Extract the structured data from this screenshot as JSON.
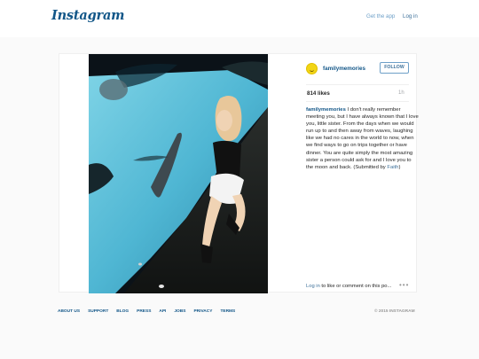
{
  "header": {
    "logo_text": "Instagram",
    "get_app": "Get the app",
    "login": "Log in"
  },
  "post": {
    "username": "familymemories",
    "follow_label": "FOLLOW",
    "likes": "814 likes",
    "time_ago": "1h",
    "caption_user": "familymemories",
    "caption_text": " I don't really remember meeting you, but I have always known that I love you, little sister. From the days when we would run up to and then away from waves, laughing like we had no cares in the world to now, when we find ways to go on trips together or have dinner. You are quite simply the most amazing sister a person could ask for and I love you to the moon and back. (Submitted by ",
    "caption_credit": "Faith",
    "caption_end": ")",
    "comment_login": "Log in",
    "comment_text": " to like or comment on this po...",
    "more_icon": "more-options-icon"
  },
  "footer": {
    "links": [
      "ABOUT US",
      "SUPPORT",
      "BLOG",
      "PRESS",
      "API",
      "JOBS",
      "PRIVACY",
      "TERMS"
    ],
    "copyright": "© 2015 INSTAGRAM"
  },
  "colors": {
    "brand": "#125688",
    "link": "#3f729b",
    "background": "#fafafa"
  }
}
